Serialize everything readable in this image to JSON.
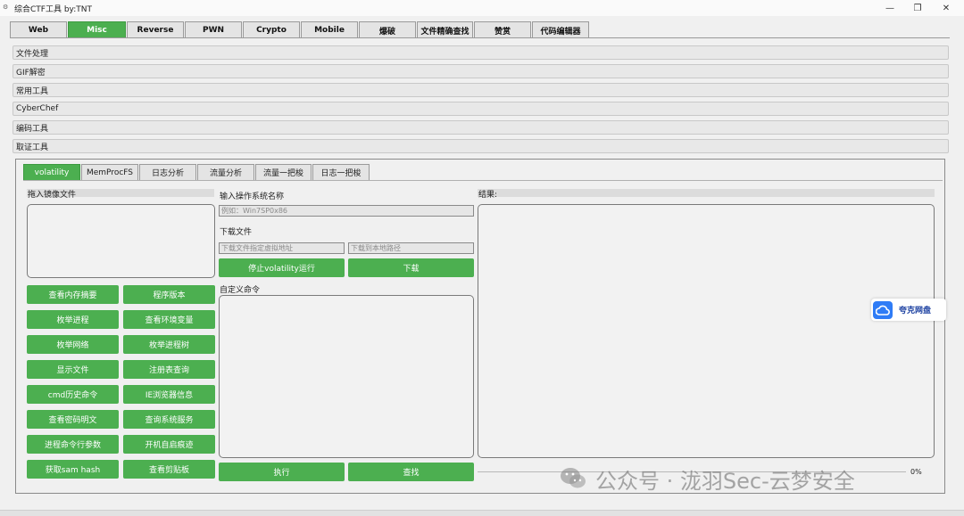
{
  "window": {
    "title": "综合CTF工具    by:TNT",
    "controls": [
      "—",
      "❐",
      "✕"
    ]
  },
  "top_tabs": [
    {
      "label": "Web",
      "active": false
    },
    {
      "label": "Misc",
      "active": true
    },
    {
      "label": "Reverse",
      "active": false
    },
    {
      "label": "PWN",
      "active": false
    },
    {
      "label": "Crypto",
      "active": false
    },
    {
      "label": "Mobile",
      "active": false
    },
    {
      "label": "爆破",
      "active": false
    },
    {
      "label": "文件精确查找",
      "active": false
    },
    {
      "label": "赞赏",
      "active": false
    },
    {
      "label": "代码编辑器",
      "active": false
    }
  ],
  "accordion": [
    {
      "label": "文件处理"
    },
    {
      "label": "GIF解密"
    },
    {
      "label": "常用工具"
    },
    {
      "label": "CyberChef"
    },
    {
      "label": "编码工具"
    },
    {
      "label": "取证工具"
    }
  ],
  "sub_tabs": [
    {
      "label": "volatility",
      "active": true
    },
    {
      "label": "MemProcFS",
      "active": false
    },
    {
      "label": "日志分析",
      "active": false
    },
    {
      "label": "流量分析",
      "active": false
    },
    {
      "label": "流量一把梭",
      "active": false
    },
    {
      "label": "日志一把梭",
      "active": false
    }
  ],
  "left": {
    "drop_label": "拖入镜像文件",
    "buttons": [
      "查看内存摘要",
      "程序版本",
      "枚举进程",
      "查看环境变量",
      "枚举网络",
      "枚举进程树",
      "显示文件",
      "注册表查询",
      "cmd历史命令",
      "IE浏览器信息",
      "查看密码明文",
      "查询系统服务",
      "进程命令行参数",
      "开机自启痕迹",
      "获取sam hash",
      "查看剪贴板"
    ]
  },
  "middle": {
    "os_label": "输入操作系统名称",
    "os_placeholder": "例如：Win7SP0x86",
    "download_label": "下载文件",
    "vaddr_placeholder": "下载文件指定虚拟地址",
    "local_placeholder": "下载到本地路径",
    "stop_button": "停止volatility运行",
    "download_button": "下载",
    "custom_label": "自定义命令",
    "exec_button": "执行",
    "find_button": "查找"
  },
  "right": {
    "result_label": "结果:",
    "progress_text": "0%",
    "progress": 0
  },
  "floater": {
    "label": "夸克网盘"
  },
  "watermark": {
    "text": "公众号 · 泷羽Sec-云梦安全"
  },
  "colors": {
    "accent": "#4caf50",
    "floater_blue": "#2f7cf6"
  }
}
